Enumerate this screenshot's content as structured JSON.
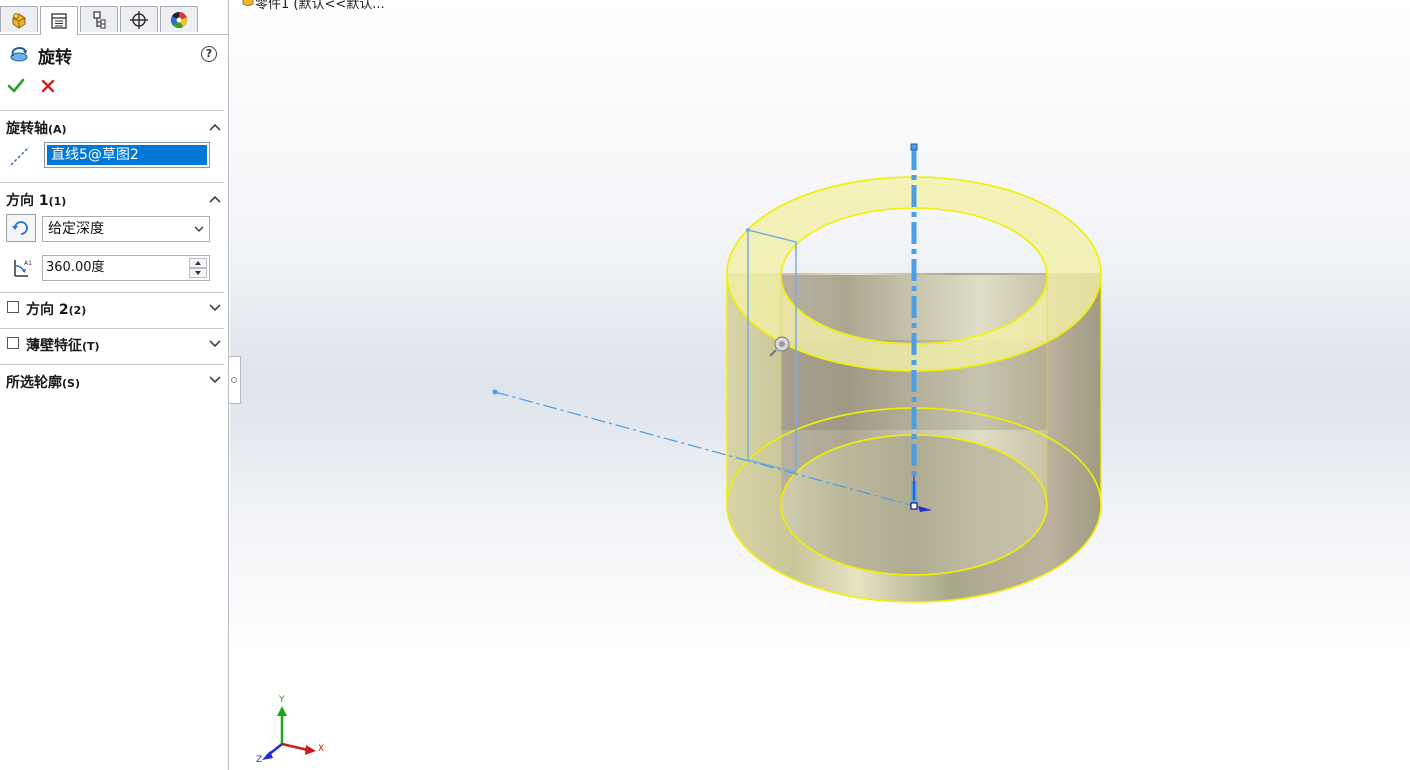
{
  "feature": {
    "title": "旋转",
    "help": "?"
  },
  "tabs": [
    "feature-manager",
    "property-manager",
    "configuration-manager",
    "dimxpert-manager",
    "display-manager"
  ],
  "sections": {
    "axis": {
      "title": "旋转轴",
      "key": "(A)",
      "value": "直线5@草图2"
    },
    "direction1": {
      "title": "方向 1",
      "key": "(1)",
      "end_condition": "给定深度",
      "angle": "360.00度"
    },
    "direction2": {
      "title": "方向 2",
      "key": "(2)",
      "checked": false
    },
    "thin": {
      "title": "薄壁特征",
      "key": "(T)",
      "checked": false
    },
    "contours": {
      "title": "所选轮廓",
      "key": "(S)"
    }
  },
  "viewport": {
    "tree_label": "零件1 (默认<<默认..."
  },
  "triad": {
    "x": "X",
    "y": "Y",
    "z": "Z"
  },
  "colors": {
    "accent_blue": "#0078d7",
    "ok_green": "#2e9e2e",
    "cancel_red": "#d32020",
    "edge_yellow": "#f2f000",
    "axis_blue": "#4a9fe8"
  }
}
